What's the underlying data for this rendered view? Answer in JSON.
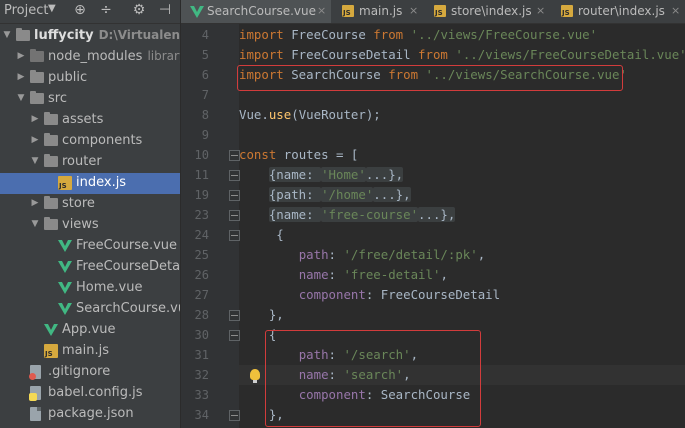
{
  "project_panel": {
    "title": "Project",
    "toolbar_icons": [
      "globe-icon",
      "split-icon",
      "gear-icon",
      "hide-icon"
    ],
    "tree": [
      {
        "depth": 0,
        "arrow": "down",
        "icon": "folder",
        "label": "luffycity",
        "hint": "D:\\Virtualenvs\\api\\l",
        "bold": true
      },
      {
        "depth": 1,
        "arrow": "right",
        "icon": "folder-gray",
        "label": "node_modules",
        "hint": "library roo"
      },
      {
        "depth": 1,
        "arrow": "right",
        "icon": "folder",
        "label": "public"
      },
      {
        "depth": 1,
        "arrow": "down",
        "icon": "folder",
        "label": "src"
      },
      {
        "depth": 2,
        "arrow": "right",
        "icon": "folder",
        "label": "assets"
      },
      {
        "depth": 2,
        "arrow": "right",
        "icon": "folder",
        "label": "components"
      },
      {
        "depth": 2,
        "arrow": "down",
        "icon": "folder",
        "label": "router"
      },
      {
        "depth": 3,
        "arrow": "",
        "icon": "js",
        "label": "index.js",
        "selected": true
      },
      {
        "depth": 2,
        "arrow": "right",
        "icon": "folder",
        "label": "store"
      },
      {
        "depth": 2,
        "arrow": "down",
        "icon": "folder",
        "label": "views"
      },
      {
        "depth": 3,
        "arrow": "",
        "icon": "vue",
        "label": "FreeCourse.vue"
      },
      {
        "depth": 3,
        "arrow": "",
        "icon": "vue",
        "label": "FreeCourseDetail.vu"
      },
      {
        "depth": 3,
        "arrow": "",
        "icon": "vue",
        "label": "Home.vue"
      },
      {
        "depth": 3,
        "arrow": "",
        "icon": "vue",
        "label": "SearchCourse.vue"
      },
      {
        "depth": 2,
        "arrow": "",
        "icon": "vue",
        "label": "App.vue"
      },
      {
        "depth": 2,
        "arrow": "",
        "icon": "js",
        "label": "main.js"
      },
      {
        "depth": 1,
        "arrow": "",
        "icon": "gitignore",
        "label": ".gitignore"
      },
      {
        "depth": 1,
        "arrow": "",
        "icon": "babel",
        "label": "babel.config.js"
      },
      {
        "depth": 1,
        "arrow": "",
        "icon": "txt",
        "label": "package.json"
      }
    ]
  },
  "tabs": [
    {
      "icon": "vue",
      "label": "SearchCourse.vue",
      "active": true
    },
    {
      "icon": "js",
      "label": "main.js"
    },
    {
      "icon": "js",
      "label": "store\\index.js"
    },
    {
      "icon": "js",
      "label": "router\\index.js"
    }
  ],
  "tab_close_symbol": "×",
  "editor": {
    "current_line": 32,
    "lines": [
      {
        "n": "4",
        "tokens": [
          [
            "kw",
            "import"
          ],
          [
            "t",
            " FreeCourse "
          ],
          [
            "kw",
            "from"
          ],
          [
            "t",
            " "
          ],
          [
            "str",
            "'../views/FreeCourse.vue'"
          ]
        ]
      },
      {
        "n": "5",
        "tokens": [
          [
            "kw",
            "import"
          ],
          [
            "t",
            " FreeCourseDetail "
          ],
          [
            "kw",
            "from"
          ],
          [
            "t",
            " "
          ],
          [
            "str",
            "'../views/FreeCourseDetail.vue'"
          ]
        ]
      },
      {
        "n": "6",
        "tokens": [
          [
            "kw",
            "import"
          ],
          [
            "t",
            " SearchCourse "
          ],
          [
            "kw",
            "from"
          ],
          [
            "t",
            " "
          ],
          [
            "str",
            "'../views/SearchCourse.vue'"
          ]
        ]
      },
      {
        "n": "7",
        "tokens": []
      },
      {
        "n": "8",
        "tokens": [
          [
            "t",
            "Vue."
          ],
          [
            "fn",
            "use"
          ],
          [
            "t",
            "(VueRouter);"
          ]
        ]
      },
      {
        "n": "9",
        "tokens": []
      },
      {
        "n": "10",
        "tokens": [
          [
            "kw",
            "const"
          ],
          [
            "t",
            " routes = ["
          ]
        ]
      },
      {
        "n": "11",
        "tokens": [
          [
            "t",
            "    "
          ],
          [
            "fold",
            "{name: "
          ],
          [
            "foldstr",
            "'Home'"
          ],
          [
            "fold",
            "...},"
          ]
        ]
      },
      {
        "n": "19",
        "tokens": [
          [
            "t",
            "    "
          ],
          [
            "fold",
            "{path: "
          ],
          [
            "foldstr",
            "'/home'"
          ],
          [
            "fold",
            "...},"
          ]
        ]
      },
      {
        "n": "23",
        "tokens": [
          [
            "t",
            "    "
          ],
          [
            "fold",
            "{name: "
          ],
          [
            "foldstr",
            "'free-course'"
          ],
          [
            "fold",
            "...},"
          ]
        ]
      },
      {
        "n": "24",
        "tokens": [
          [
            "t",
            "     {"
          ]
        ]
      },
      {
        "n": "25",
        "tokens": [
          [
            "t",
            "        "
          ],
          [
            "prop",
            "path"
          ],
          [
            "t",
            ": "
          ],
          [
            "str",
            "'/free/detail/:pk'"
          ],
          [
            "t",
            ","
          ]
        ]
      },
      {
        "n": "26",
        "tokens": [
          [
            "t",
            "        "
          ],
          [
            "prop",
            "name"
          ],
          [
            "t",
            ": "
          ],
          [
            "str",
            "'free-detail'"
          ],
          [
            "t",
            ","
          ]
        ]
      },
      {
        "n": "27",
        "tokens": [
          [
            "t",
            "        "
          ],
          [
            "prop",
            "component"
          ],
          [
            "t",
            ": FreeCourseDetail"
          ]
        ]
      },
      {
        "n": "28",
        "tokens": [
          [
            "t",
            "    },"
          ]
        ]
      },
      {
        "n": "30",
        "tokens": [
          [
            "t",
            "    {"
          ]
        ]
      },
      {
        "n": "31",
        "tokens": [
          [
            "t",
            "        "
          ],
          [
            "prop",
            "path"
          ],
          [
            "t",
            ": "
          ],
          [
            "str",
            "'/search'"
          ],
          [
            "t",
            ","
          ]
        ]
      },
      {
        "n": "32",
        "tokens": [
          [
            "t",
            "        "
          ],
          [
            "prop",
            "name"
          ],
          [
            "t",
            ": "
          ],
          [
            "str",
            "'search'"
          ],
          [
            "t",
            ","
          ]
        ]
      },
      {
        "n": "33",
        "tokens": [
          [
            "t",
            "        "
          ],
          [
            "prop",
            "component"
          ],
          [
            "t",
            ": SearchCourse"
          ]
        ]
      },
      {
        "n": "34",
        "tokens": [
          [
            "t",
            "    },"
          ]
        ]
      }
    ]
  },
  "colors": {
    "keyword": "#cc7832",
    "string": "#6a8759",
    "property": "#9876aa",
    "function": "#ffc66d",
    "highlight_box": "#d23c3c",
    "selection": "#4b6eaf"
  }
}
